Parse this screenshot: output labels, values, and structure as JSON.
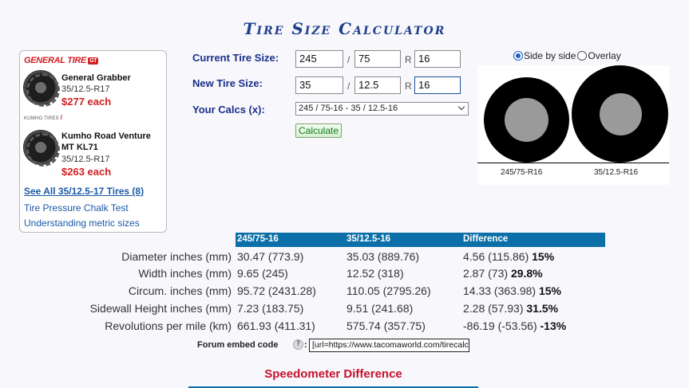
{
  "title": "Tire Size Calculator",
  "ad": {
    "brand1": "GENERAL TIRE",
    "brand1_badge": "GT",
    "item1": {
      "name": "General Grabber",
      "size": "35/12.5-R17",
      "price": "$277 each"
    },
    "brand2": "KUMHO TIRES",
    "item2": {
      "name_line1": "Kumho Road Venture",
      "name_line2": "MT KL71",
      "size": "35/12.5-R17",
      "price": "$263 each"
    },
    "see_all": "See All 35/12.5-17 Tires (8)",
    "link1": "Tire Pressure Chalk Test",
    "link2": "Understanding metric sizes"
  },
  "form": {
    "current_label": "Current Tire Size:",
    "new_label": "New Tire Size:",
    "calcs_label": "Your Calcs (x):",
    "current": {
      "width": "245",
      "ratio": "75",
      "rim": "16"
    },
    "new": {
      "width": "35",
      "ratio": "12.5",
      "rim": "16"
    },
    "slash": "/",
    "r": "R",
    "calcs_selected": "245 / 75-16 - 35 / 12.5-16",
    "calculate": "Calculate"
  },
  "view": {
    "side_by_side": "Side by side",
    "overlay": "Overlay",
    "selected": "side_by_side",
    "tire1_label": "245/75-R16",
    "tire2_label": "35/12.5-R16"
  },
  "table": {
    "headers": [
      "245/75-16",
      "35/12.5-16",
      "Difference"
    ],
    "rows": [
      {
        "label": "Diameter inches (mm)",
        "a": "30.47 (773.9)",
        "b": "35.03 (889.76)",
        "diff": "4.56 (115.86)",
        "pct": "15%"
      },
      {
        "label": "Width inches (mm)",
        "a": "9.65 (245)",
        "b": "12.52 (318)",
        "diff": "2.87 (73)",
        "pct": "29.8%"
      },
      {
        "label": "Circum. inches (mm)",
        "a": "95.72 (2431.28)",
        "b": "110.05 (2795.26)",
        "diff": "14.33 (363.98)",
        "pct": "15%"
      },
      {
        "label": "Sidewall Height inches (mm)",
        "a": "7.23 (183.75)",
        "b": "9.51 (241.68)",
        "diff": "2.28 (57.93)",
        "pct": "31.5%"
      },
      {
        "label": "Revolutions per mile (km)",
        "a": "661.93 (411.31)",
        "b": "575.74 (357.75)",
        "diff": "-86.19 (-53.56)",
        "pct": "-13%"
      }
    ]
  },
  "embed": {
    "label": "Forum embed code",
    "help": "?",
    "colon": ":",
    "value": "[url=https://www.tacomaworld.com/tirecalc"
  },
  "speedo_heading": "Speedometer Difference"
}
